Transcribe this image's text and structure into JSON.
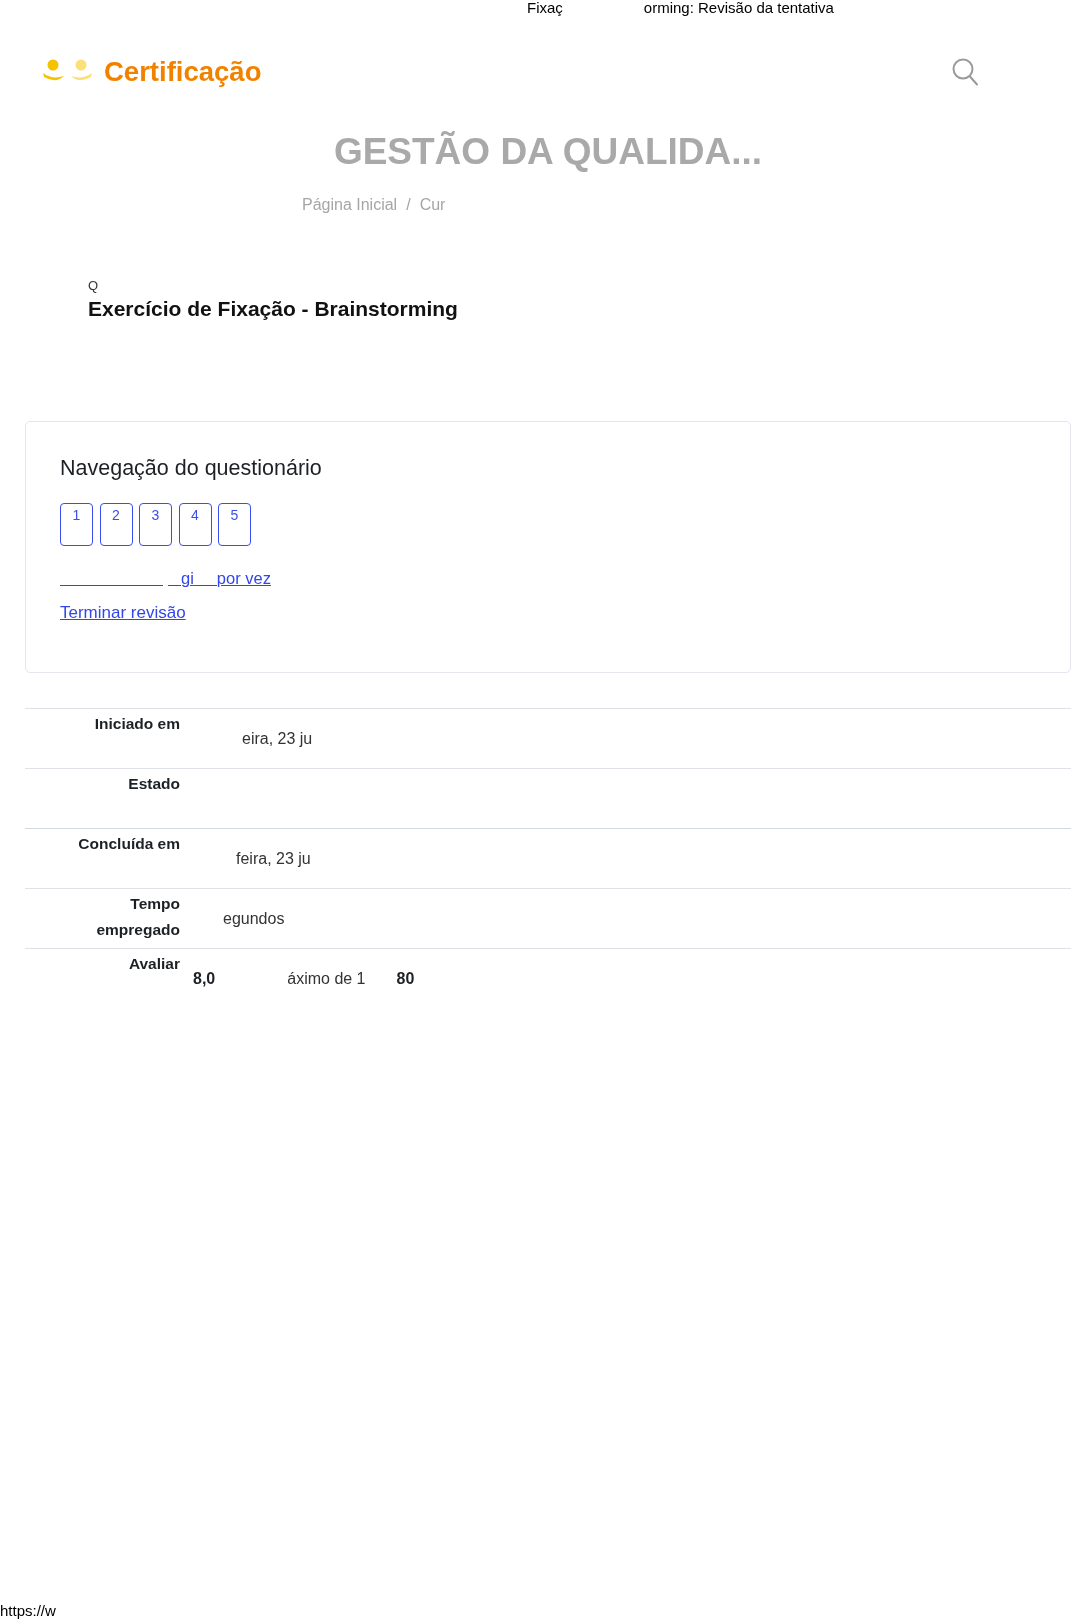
{
  "print_header": {
    "left": "Fixaç",
    "right": "orming: Revisão da tentativa"
  },
  "logo": {
    "text": "Certificação"
  },
  "course_title": "GESTÃO DA QUALIDA...",
  "breadcrumb": {
    "items": [
      {
        "label": "Página Inicial"
      },
      {
        "label": "Cur"
      }
    ],
    "separator": "/"
  },
  "quiz": {
    "prefix": "Q",
    "title": "Exercício de Fixação - Brainstorming"
  },
  "navigation": {
    "title": "Navegação do questionário",
    "questions": [
      {
        "label": "1"
      },
      {
        "label": "2"
      },
      {
        "label": "3"
      },
      {
        "label": "4"
      },
      {
        "label": "5"
      }
    ],
    "page_link": {
      "fragments": [
        "gi",
        "por vez"
      ]
    },
    "finish_link": "Terminar revisão"
  },
  "summary": [
    {
      "label": "Iniciado em",
      "value": [
        {
          "text": "eira, 23 ju",
          "bold": false
        }
      ]
    },
    {
      "label": "Estado"
    },
    {
      "label": "Concluída em",
      "value": [
        {
          "text": "feira, 23 ju",
          "bold": false
        }
      ]
    },
    {
      "label": "Tempo empregado",
      "value": [
        {
          "text": "egundos",
          "bold": false
        }
      ]
    },
    {
      "label": "Avaliar",
      "value": [
        {
          "text": "8,0",
          "bold": true
        },
        {
          "text": "áximo de 1",
          "bold": false
        },
        {
          "text": "80",
          "bold": true
        }
      ]
    }
  ],
  "print_footer": "https://w"
}
